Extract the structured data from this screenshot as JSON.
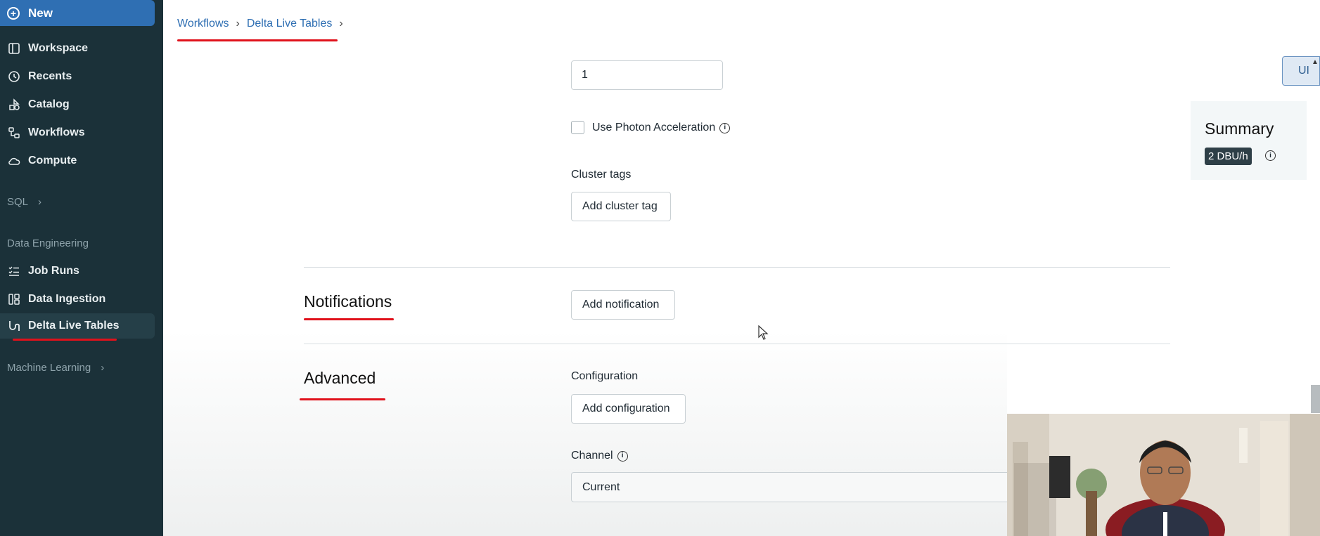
{
  "sidebar": {
    "new_label": "New",
    "items": [
      {
        "label": "Workspace",
        "icon": "workspace-icon"
      },
      {
        "label": "Recents",
        "icon": "clock-icon"
      },
      {
        "label": "Catalog",
        "icon": "catalog-icon"
      },
      {
        "label": "Workflows",
        "icon": "workflows-icon"
      },
      {
        "label": "Compute",
        "icon": "cloud-icon"
      }
    ],
    "sql_label": "SQL",
    "data_engineering_label": "Data Engineering",
    "de_items": [
      {
        "label": "Job Runs",
        "icon": "list-icon"
      },
      {
        "label": "Data Ingestion",
        "icon": "ingestion-icon"
      },
      {
        "label": "Delta Live Tables",
        "icon": "pipeline-icon"
      }
    ],
    "machine_learning_label": "Machine Learning"
  },
  "breadcrumb": {
    "items": [
      "Workflows",
      "Delta Live Tables"
    ]
  },
  "compute": {
    "workers_value": "1",
    "photon_label": "Use Photon Acceleration",
    "photon_checked": false,
    "cluster_tags_label": "Cluster tags",
    "add_cluster_tag": "Add cluster tag"
  },
  "notifications": {
    "title": "Notifications",
    "add_label": "Add notification"
  },
  "advanced": {
    "title": "Advanced",
    "configuration_label": "Configuration",
    "add_configuration": "Add configuration",
    "channel_label": "Channel",
    "channel_value": "Current"
  },
  "summary": {
    "ui_button": "UI",
    "title": "Summary",
    "dbu": "2 DBU/h"
  },
  "colors": {
    "sidebar_bg": "#1b3139",
    "accent": "#2f6fb3",
    "annotation_red": "#e0111b"
  }
}
